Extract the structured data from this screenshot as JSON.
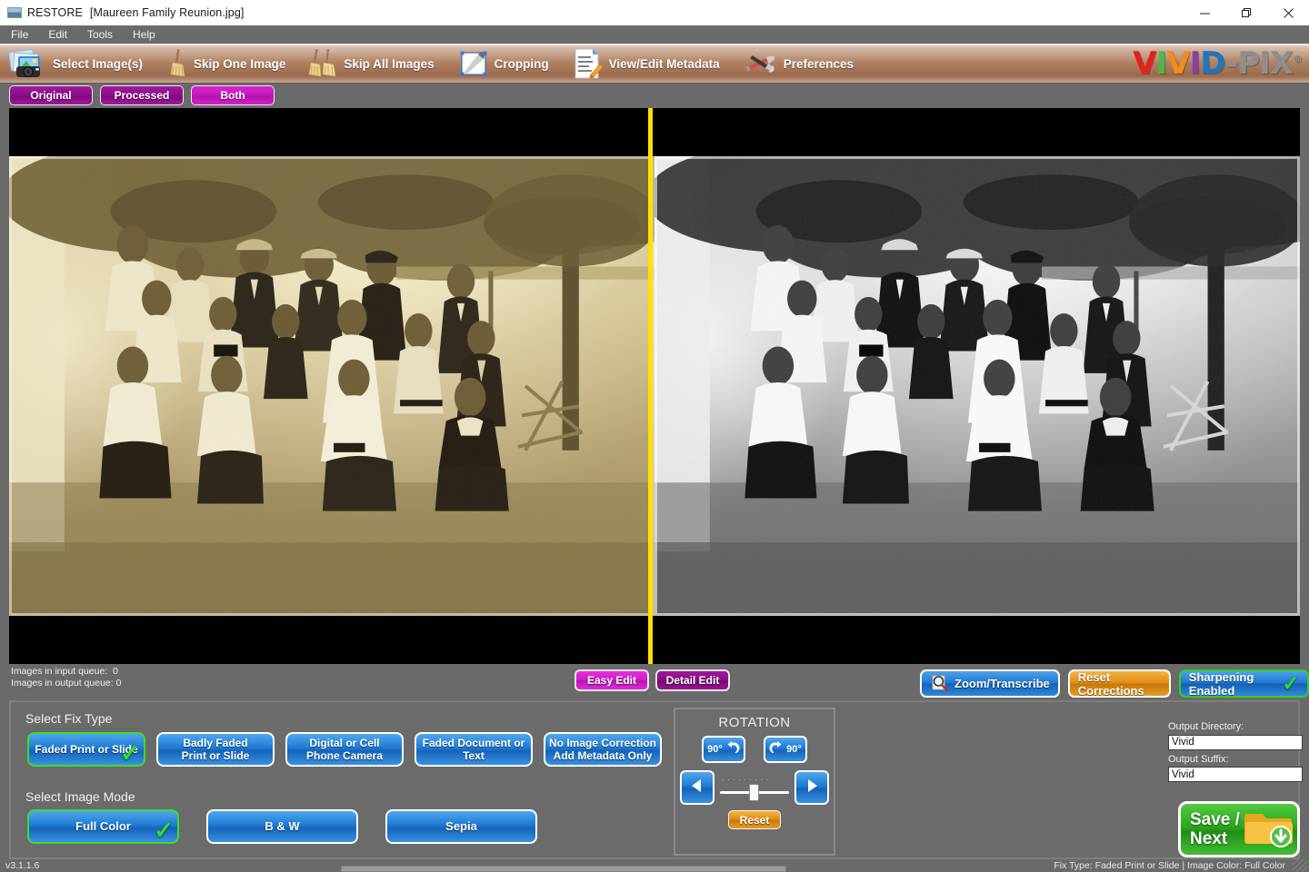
{
  "window": {
    "app_name": "RESTORE",
    "file_title": "[Maureen Family Reunion.jpg]",
    "app_icon": "photo-window-icon",
    "minimize": "minimize-icon",
    "maximize": "restore-icon",
    "close": "close-icon"
  },
  "menu": {
    "items": [
      {
        "label": "File"
      },
      {
        "label": "Edit"
      },
      {
        "label": "Tools"
      },
      {
        "label": "Help"
      }
    ]
  },
  "toolbar": {
    "items": [
      {
        "label": "Select Image(s)",
        "icon": "camera-photos-icon"
      },
      {
        "label": "Skip One Image",
        "icon": "single-broom-icon"
      },
      {
        "label": "Skip All Images",
        "icon": "double-broom-icon"
      },
      {
        "label": "Cropping",
        "icon": "crop-pen-icon"
      },
      {
        "label": "View/Edit Metadata",
        "icon": "document-pencil-icon"
      },
      {
        "label": "Preferences",
        "icon": "screwdriver-wrench-icon"
      }
    ],
    "logo": {
      "letters": [
        {
          "ch": "V",
          "color": "#e32119"
        },
        {
          "ch": "I",
          "color": "#4db848"
        },
        {
          "ch": "V",
          "color": "#f28a1e"
        },
        {
          "ch": "I",
          "color": "#8a3fa8"
        },
        {
          "ch": "D",
          "color": "#1c77c3"
        },
        {
          "ch": "-",
          "color": "#8e8e8e"
        },
        {
          "ch": "P",
          "color": "#8e8e8e"
        },
        {
          "ch": "I",
          "color": "#8e8e8e"
        },
        {
          "ch": "X",
          "color": "#8e8e8e"
        }
      ],
      "trademark": "®"
    }
  },
  "view_tabs": {
    "items": [
      {
        "label": "Original",
        "active": false
      },
      {
        "label": "Processed",
        "active": false
      },
      {
        "label": "Both",
        "active": true
      }
    ]
  },
  "viewer": {
    "left_pane": {
      "name": "original-image",
      "caption": "Original faded sepia group photograph"
    },
    "right_pane": {
      "name": "processed-image",
      "caption": "Processed high-contrast black and white group photograph"
    },
    "divider_color": "#ffe000"
  },
  "queue": {
    "input_label": "Images in input queue:",
    "input_count": "0",
    "output_label": "Images in output queue:",
    "output_count": "0"
  },
  "edit_modes": {
    "items": [
      {
        "label": "Easy Edit",
        "active": true
      },
      {
        "label": "Detail Edit",
        "active": false
      }
    ]
  },
  "actions": {
    "zoom_transcribe": "Zoom/Transcribe",
    "reset_corrections": "Reset Corrections",
    "sharpening": "Sharpening Enabled",
    "sharpening_checked": true
  },
  "fix_type": {
    "title": "Select Fix Type",
    "options": [
      {
        "line1": "Faded Print or Slide",
        "line2": "",
        "selected": true
      },
      {
        "line1": "Badly Faded",
        "line2": "Print or Slide",
        "selected": false
      },
      {
        "line1": "Digital or Cell",
        "line2": "Phone Camera",
        "selected": false
      },
      {
        "line1": "Faded Document or",
        "line2": "Text",
        "selected": false
      },
      {
        "line1": "No Image Correction",
        "line2": "Add Metadata Only",
        "selected": false
      }
    ]
  },
  "image_mode": {
    "title": "Select Image Mode",
    "options": [
      {
        "label": "Full Color",
        "selected": true
      },
      {
        "label": "B & W",
        "selected": false
      },
      {
        "label": "Sepia",
        "selected": false
      }
    ]
  },
  "rotation": {
    "title": "ROTATION",
    "rotate_left": "90°",
    "rotate_right": "90°",
    "nudge_left_icon": "triangle-left-icon",
    "nudge_right_icon": "triangle-right-icon",
    "slider_value": "0",
    "reset": "Reset"
  },
  "output": {
    "directory_label": "Output Directory:",
    "directory_value": "Vivid",
    "suffix_label": "Output Suffix:",
    "suffix_value": "Vivid"
  },
  "save": {
    "line1": "Save /",
    "line2": "Next",
    "icon": "folder-download-icon"
  },
  "status": {
    "version": "v3.1.1.6",
    "fix_status": "Fix Type:  Faded Print or Slide | Image Color: Full Color"
  }
}
